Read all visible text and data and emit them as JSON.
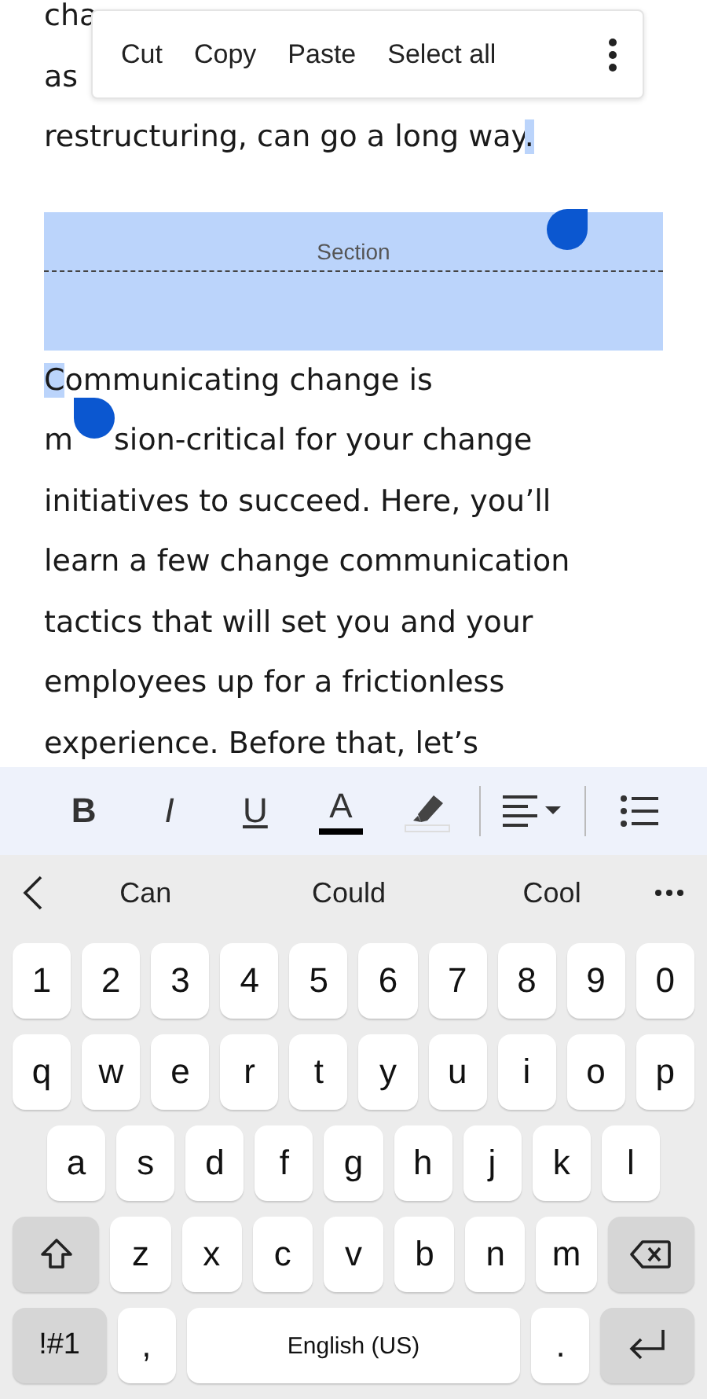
{
  "context_menu": {
    "items": [
      "Cut",
      "Copy",
      "Paste",
      "Select all"
    ]
  },
  "document": {
    "lines_before": [
      [
        {
          "text": "cha",
          "selected": false
        }
      ],
      [
        {
          "text": "as",
          "selected": false
        }
      ],
      [
        {
          "text": "restructuring, can go a long way",
          "selected": false
        },
        {
          "text": ".",
          "selected": true
        }
      ]
    ],
    "section_label": "Section",
    "section_selected": true,
    "lines_after": [
      [
        {
          "text": "C",
          "selected": true
        },
        {
          "text": "ommunicating change is",
          "selected": false
        }
      ],
      [
        {
          "text": "m",
          "selected": false
        },
        {
          "kind": "handle"
        },
        {
          "text": "sion-critical for your change",
          "selected": false
        }
      ],
      [
        {
          "text": "initiatives to succeed. Here, you’ll",
          "selected": false
        }
      ],
      [
        {
          "text": "learn a few change communication",
          "selected": false
        }
      ],
      [
        {
          "text": "tactics that will set you and your",
          "selected": false
        }
      ],
      [
        {
          "text": "employees up for a frictionless",
          "selected": false
        }
      ],
      [
        {
          "text": "experience. Before that, let’s",
          "selected": false
        }
      ]
    ]
  },
  "format_toolbar": [
    {
      "kind": "bold",
      "label": "B"
    },
    {
      "kind": "italic",
      "label": "I"
    },
    {
      "kind": "underline",
      "label": "U"
    },
    {
      "kind": "font_color",
      "label": "A"
    },
    {
      "kind": "highlight"
    },
    {
      "kind": "divider"
    },
    {
      "kind": "align"
    },
    {
      "kind": "divider"
    },
    {
      "kind": "list"
    }
  ],
  "suggestions": [
    "Can",
    "Could",
    "Cool"
  ],
  "keyboard": {
    "number_row": [
      {
        "kind": "char",
        "label": "1"
      },
      {
        "kind": "char",
        "label": "2"
      },
      {
        "kind": "char",
        "label": "3"
      },
      {
        "kind": "char",
        "label": "4"
      },
      {
        "kind": "char",
        "label": "5"
      },
      {
        "kind": "char",
        "label": "6"
      },
      {
        "kind": "char",
        "label": "7"
      },
      {
        "kind": "char",
        "label": "8"
      },
      {
        "kind": "char",
        "label": "9"
      },
      {
        "kind": "char",
        "label": "0"
      }
    ],
    "top_row": [
      {
        "kind": "char",
        "label": "q"
      },
      {
        "kind": "char",
        "label": "w"
      },
      {
        "kind": "char",
        "label": "e"
      },
      {
        "kind": "char",
        "label": "r"
      },
      {
        "kind": "char",
        "label": "t"
      },
      {
        "kind": "char",
        "label": "y"
      },
      {
        "kind": "char",
        "label": "u"
      },
      {
        "kind": "char",
        "label": "i"
      },
      {
        "kind": "char",
        "label": "o"
      },
      {
        "kind": "char",
        "label": "p"
      }
    ],
    "home_row": [
      {
        "kind": "char",
        "label": "a"
      },
      {
        "kind": "char",
        "label": "s"
      },
      {
        "kind": "char",
        "label": "d"
      },
      {
        "kind": "char",
        "label": "f"
      },
      {
        "kind": "char",
        "label": "g"
      },
      {
        "kind": "char",
        "label": "h"
      },
      {
        "kind": "char",
        "label": "j"
      },
      {
        "kind": "char",
        "label": "k"
      },
      {
        "kind": "char",
        "label": "l"
      }
    ],
    "lower_row": [
      {
        "kind": "shift"
      },
      {
        "kind": "char",
        "label": "z"
      },
      {
        "kind": "char",
        "label": "x"
      },
      {
        "kind": "char",
        "label": "c"
      },
      {
        "kind": "char",
        "label": "v"
      },
      {
        "kind": "char",
        "label": "b"
      },
      {
        "kind": "char",
        "label": "n"
      },
      {
        "kind": "char",
        "label": "m"
      },
      {
        "kind": "backspace"
      }
    ],
    "function_row": [
      {
        "kind": "symbols",
        "label": "!#1"
      },
      {
        "kind": "char",
        "label": ","
      },
      {
        "kind": "space",
        "label": "English (US)"
      },
      {
        "kind": "char",
        "label": "."
      },
      {
        "kind": "enter"
      }
    ]
  }
}
